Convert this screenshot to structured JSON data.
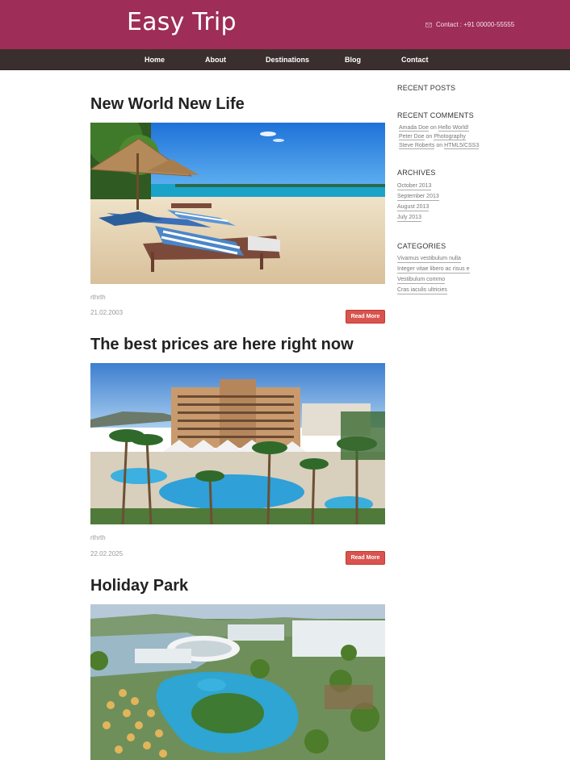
{
  "header": {
    "brand": "Easy Trip",
    "contact": "Contact : +91 00000-55555",
    "mail_icon": "mail-icon",
    "bg": "#9e2d57"
  },
  "nav": {
    "items": [
      "Home",
      "About",
      "Destinations",
      "Blog",
      "Contact"
    ],
    "bg": "#3a2f2e"
  },
  "posts": [
    {
      "title": "New World New Life",
      "author": "rthrth",
      "date": "21.02.2003",
      "read_more": "Read More",
      "image": "beach-loungers-image"
    },
    {
      "title": "The best prices are here right now",
      "author": "rthrth",
      "date": "22.02.2025",
      "read_more": "Read More",
      "image": "hotel-pool-image"
    },
    {
      "title": "Holiday Park",
      "image": "resort-aerial-image"
    }
  ],
  "sidebar": {
    "recent_posts": {
      "heading": "RECENT POSTS"
    },
    "recent_comments": {
      "heading": "RECENT COMMENTS",
      "items": [
        {
          "author": "Amada Doe",
          "on": "on",
          "post": "Hello World!"
        },
        {
          "author": "Peter Doe",
          "on": "on",
          "post": "Photography"
        },
        {
          "author": "Steve Roberts",
          "on": "on",
          "post": "HTML5/CSS3"
        }
      ]
    },
    "archives": {
      "heading": "ARCHIVES",
      "items": [
        "October 2013",
        "September 2013",
        "August 2013",
        "July 2013"
      ]
    },
    "categories": {
      "heading": "CATEGORIES",
      "items": [
        "Vivamus vestibulum nulla",
        "Integer vitae libero ac risus e",
        "Vestibulum commo",
        "Cras iaculis ultricies"
      ]
    }
  },
  "colors": {
    "accent": "#9e2d57",
    "button": "#d9534f"
  }
}
